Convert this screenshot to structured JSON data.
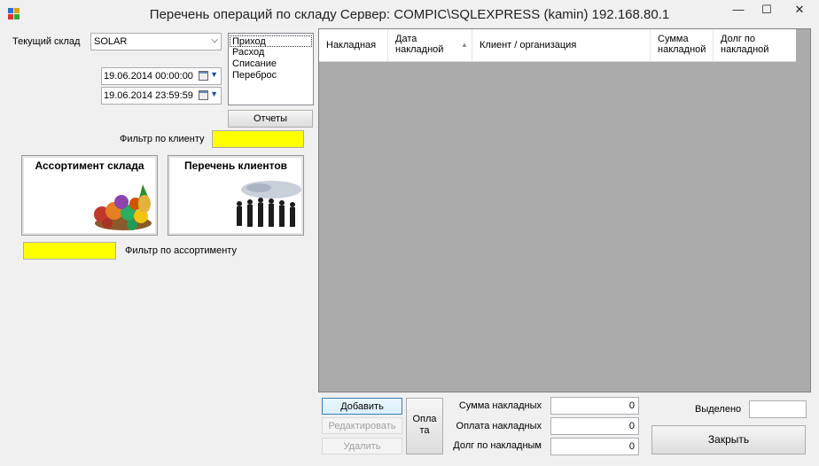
{
  "window": {
    "title": "Перечень операций по складу  Сервер: COMPIC\\SQLEXPRESS (kamin) 192.168.80.1",
    "minimize": "—",
    "maximize": "☐",
    "close": "✕"
  },
  "filters": {
    "warehouse_label": "Текущий склад",
    "warehouse_value": "SOLAR",
    "date_from": "19.06.2014 00:00:00",
    "date_to": "19.06.2014 23:59:59",
    "operation_types": [
      "Приход",
      "Расход",
      "Списание",
      "Переброс"
    ],
    "operation_selected": "Приход",
    "reports_button": "Отчеты",
    "client_filter_label": "Фильтр по клиенту",
    "client_filter_value": "",
    "assortment_filter_label": "Фильтр по ассортименту",
    "assortment_filter_value": ""
  },
  "panels": {
    "assortment": "Ассортимент склада",
    "clients": "Перечень клиентов"
  },
  "grid": {
    "columns": [
      "Накладная",
      "Дата накладной",
      "Клиент / организация",
      "Сумма накладной",
      "Долг по накладной"
    ],
    "sorted_column": "Дата накладной",
    "rows": []
  },
  "actions": {
    "add": "Добавить",
    "edit": "Редактировать",
    "delete": "Удалить",
    "payment_line1": "Опла",
    "payment_line2": "та"
  },
  "totals": {
    "sum_label": "Сумма накладных",
    "sum_value": "0",
    "paid_label": "Оплата накладных",
    "paid_value": "0",
    "debt_label": "Долг по накладным",
    "debt_value": "0",
    "selected_label": "Выделено",
    "selected_value": "",
    "close_button": "Закрыть"
  },
  "colors": {
    "filter_highlight": "#ffff00",
    "grid_background": "#ababab",
    "selection_accent": "#3399ff"
  }
}
